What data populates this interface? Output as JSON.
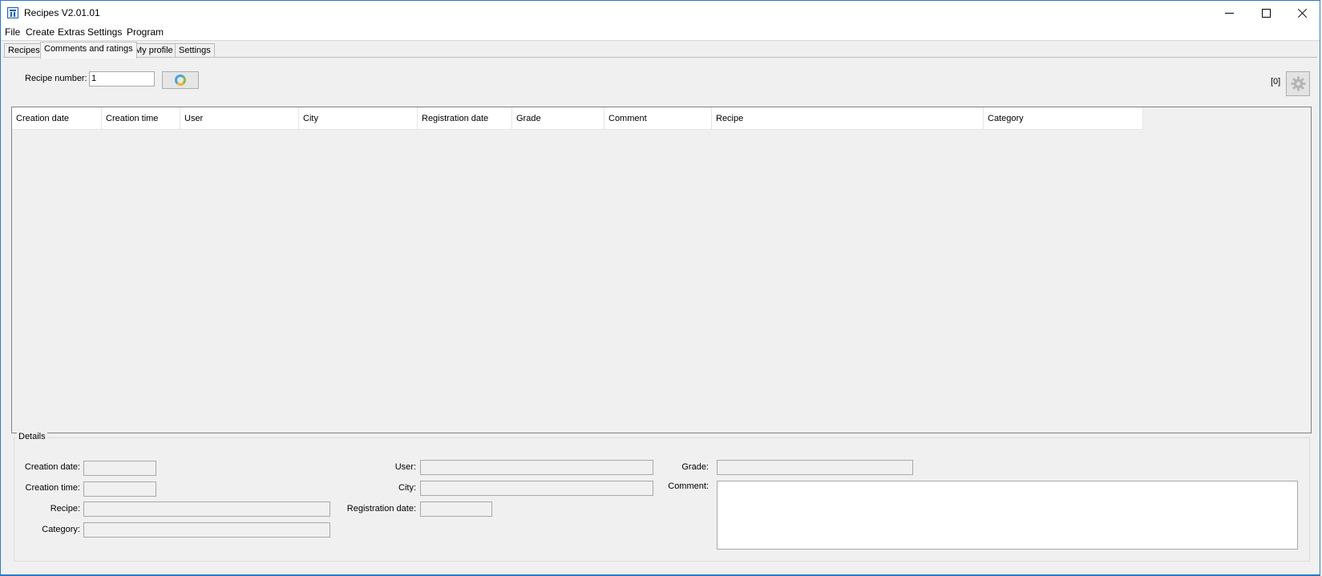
{
  "window": {
    "title": "Recipes V2.01.01"
  },
  "menu": [
    "File",
    "Create",
    "Extras",
    "Settings",
    "Program"
  ],
  "tabs": [
    "Recipes",
    "Comments and ratings",
    "My profile",
    "Settings"
  ],
  "active_tab": "Comments and ratings",
  "search": {
    "label": "Recipe number:",
    "value": "1"
  },
  "count": "[0]",
  "table": {
    "columns": [
      "Creation date",
      "Creation time",
      "User",
      "City",
      "Registration date",
      "Grade",
      "Comment",
      "Recipe",
      "Category"
    ],
    "rows": []
  },
  "details": {
    "title": "Details",
    "creation_date_label": "Creation date:",
    "creation_time_label": "Creation time:",
    "recipe_label": "Recipe:",
    "category_label": "Category:",
    "user_label": "User:",
    "city_label": "City:",
    "registration_date_label": "Registration date:",
    "grade_label": "Grade:",
    "comment_label": "Comment:",
    "creation_date": "",
    "creation_time": "",
    "recipe": "",
    "category": "",
    "user": "",
    "city": "",
    "registration_date": "",
    "grade": "",
    "comment": ""
  },
  "icons": {
    "app": "app-icon",
    "refresh": "refresh-icon",
    "settings": "gear-icon",
    "minimize": "minimize-icon",
    "maximize": "maximize-icon",
    "close": "close-icon"
  },
  "colors": {
    "window_border": "#2b79c8",
    "background": "#f0f0f0"
  }
}
